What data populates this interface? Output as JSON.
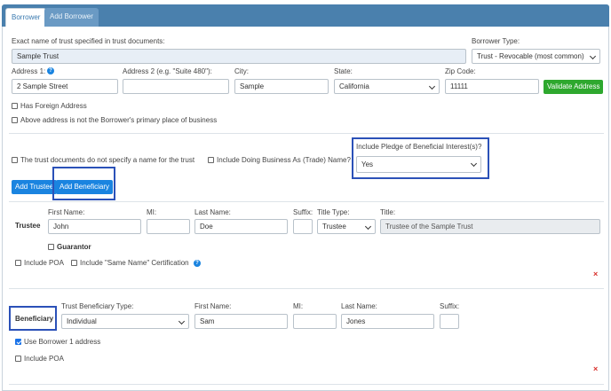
{
  "tabs": {
    "borrower": "Borrower",
    "add_borrower": "Add Borrower"
  },
  "trust": {
    "name_label": "Exact name of trust specified in trust documents:",
    "name_value": "Sample Trust",
    "type_label": "Borrower Type:",
    "type_value": "Trust - Revocable (most common)"
  },
  "address": {
    "address1_label": "Address 1:",
    "address1_value": "2 Sample Street",
    "address2_label": "Address 2 (e.g. \"Suite 480\"):",
    "address2_value": "",
    "city_label": "City:",
    "city_value": "Sample",
    "state_label": "State:",
    "state_value": "California",
    "zip_label": "Zip Code:",
    "zip_value": "11111",
    "validate_button": "Validate Address",
    "foreign_label": "Has Foreign Address",
    "not_primary_label": "Above address is not the Borrower's primary place of business"
  },
  "options": {
    "no_name_label": "The trust documents do not specify a name for the trust",
    "dba_label": "Include Doing Business As (Trade) Name?",
    "pledge_label": "Include Pledge of Beneficial Interest(s)?",
    "pledge_value": "Yes",
    "add_trustee_button": "Add Trustee",
    "add_beneficiary_button": "Add Beneficiary"
  },
  "trustee": {
    "section_label": "Trustee",
    "first_name_label": "First Name:",
    "first_name_value": "John",
    "mi_label": "MI:",
    "mi_value": "",
    "last_name_label": "Last Name:",
    "last_name_value": "Doe",
    "suffix_label": "Suffix:",
    "suffix_value": "",
    "title_type_label": "Title Type:",
    "title_type_value": "Trustee",
    "title_label": "Title:",
    "title_value": "Trustee of the Sample Trust",
    "guarantor_label": "Guarantor",
    "poa_label": "Include POA",
    "same_name_label": "Include \"Same Name\" Certification",
    "remove_icon": "×"
  },
  "beneficiary": {
    "section_label": "Beneficiary",
    "type_label": "Trust Beneficiary Type:",
    "type_value": "Individual",
    "first_name_label": "First Name:",
    "first_name_value": "Sam",
    "mi_label": "MI:",
    "mi_value": "",
    "last_name_label": "Last Name:",
    "last_name_value": "Jones",
    "suffix_label": "Suffix:",
    "suffix_value": "",
    "use_address_label": "Use Borrower 1 address",
    "poa_label": "Include POA",
    "remove_icon": "×"
  },
  "colors": {
    "tab_bar": "#4a80ad",
    "primary_button": "#1a84e0",
    "validate_button": "#2ea82e",
    "highlight_box": "#2b51b8",
    "remove_icon": "#d9302c"
  }
}
